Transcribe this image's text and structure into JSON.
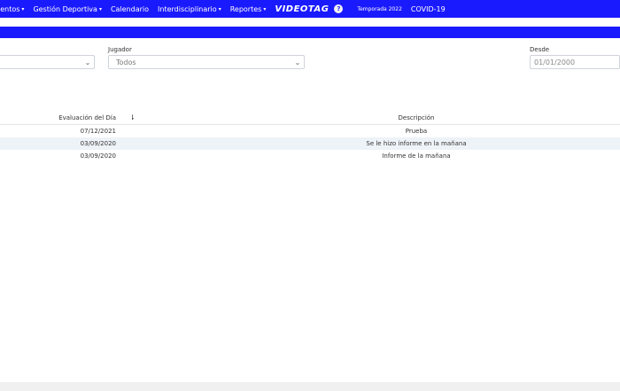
{
  "nav": {
    "items": [
      {
        "label": "ientos",
        "caret": "▾"
      },
      {
        "label": "Gestión Deportiva",
        "caret": "▾"
      },
      {
        "label": "Calendario",
        "caret": ""
      },
      {
        "label": "Interdisciplinario",
        "caret": "▾"
      },
      {
        "label": "Reportes",
        "caret": "▾"
      }
    ],
    "brand": "VIDEOTAG",
    "help": "?",
    "season": "Temporada 2022",
    "covid": "COVID-19"
  },
  "filters": {
    "player_label": "Jugador",
    "player_value": "Todos",
    "since_label": "Desde",
    "since_value": "01/01/2000"
  },
  "table": {
    "headers": {
      "date": "Evaluación del Día",
      "description": "Descripción"
    },
    "sort_icon": "⇂",
    "rows": [
      {
        "date": "07/12/2021",
        "description": "Prueba"
      },
      {
        "date": "03/09/2020",
        "description": "Se le hizo informe en la mañana"
      },
      {
        "date": "03/09/2020",
        "description": "Informe de la mañana"
      }
    ]
  },
  "colors": {
    "nav": "#1a1aff",
    "row_alt": "#eef3f8"
  }
}
